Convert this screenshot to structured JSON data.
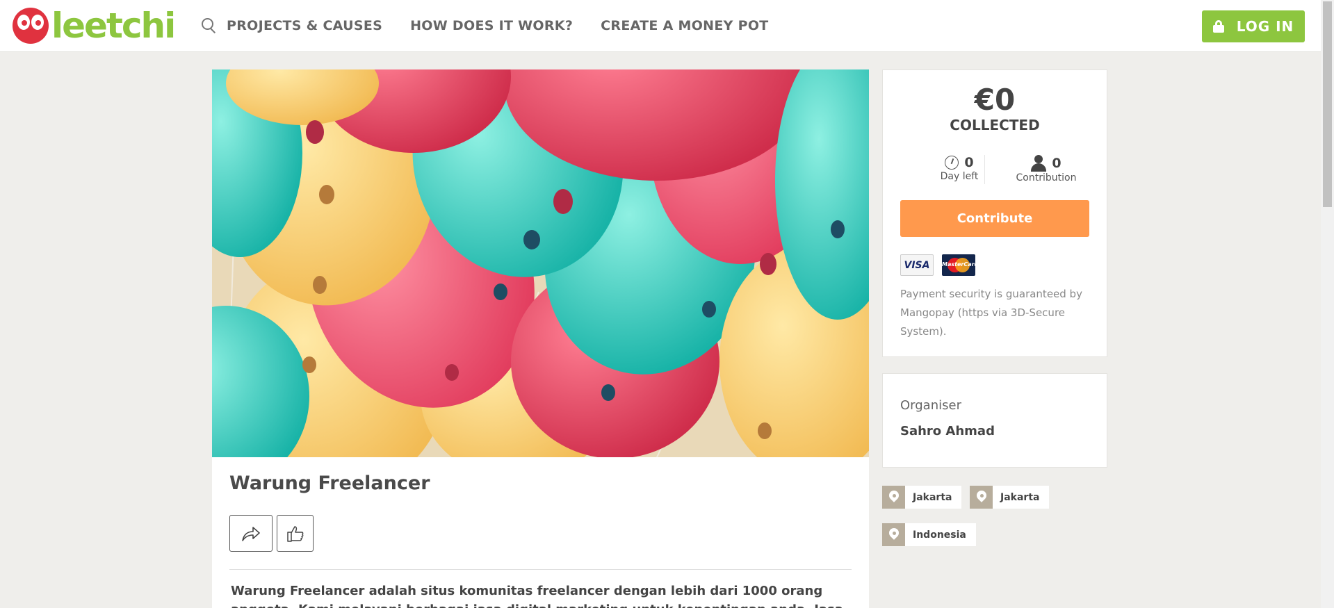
{
  "header": {
    "logo_text": "leetchi",
    "nav": [
      {
        "label": "PROJECTS & CAUSES"
      },
      {
        "label": "HOW DOES IT WORK?"
      },
      {
        "label": "CREATE A MONEY POT"
      }
    ],
    "login_label": "LOG IN",
    "brand_color": "#8dc63f",
    "logo_color": "#e0323f"
  },
  "project": {
    "title": "Warung Freelancer",
    "description": "Warung Freelancer adalah situs komunitas freelancer dengan lebih dari 1000 orang anggota. Kami melayani berbagai jasa digital marketing untuk kepentingan anda. Jasa seperti review produk"
  },
  "stats": {
    "amount": "€0",
    "collected_label": "COLLECTED",
    "days_value": "0",
    "days_label": "Day left",
    "contrib_value": "0",
    "contrib_label": "Contribution",
    "contribute_label": "Contribute",
    "contribute_color": "#ff994d",
    "visa_label": "VISA",
    "mastercard_label": "MasterCard",
    "security_text": "Payment security is guaranteed by Mangopay (https via 3D-Secure System)."
  },
  "organiser": {
    "label": "Organiser",
    "name": "Sahro Ahmad"
  },
  "tags": [
    {
      "label": "Jakarta"
    },
    {
      "label": "Jakarta"
    },
    {
      "label": "Indonesia"
    }
  ]
}
